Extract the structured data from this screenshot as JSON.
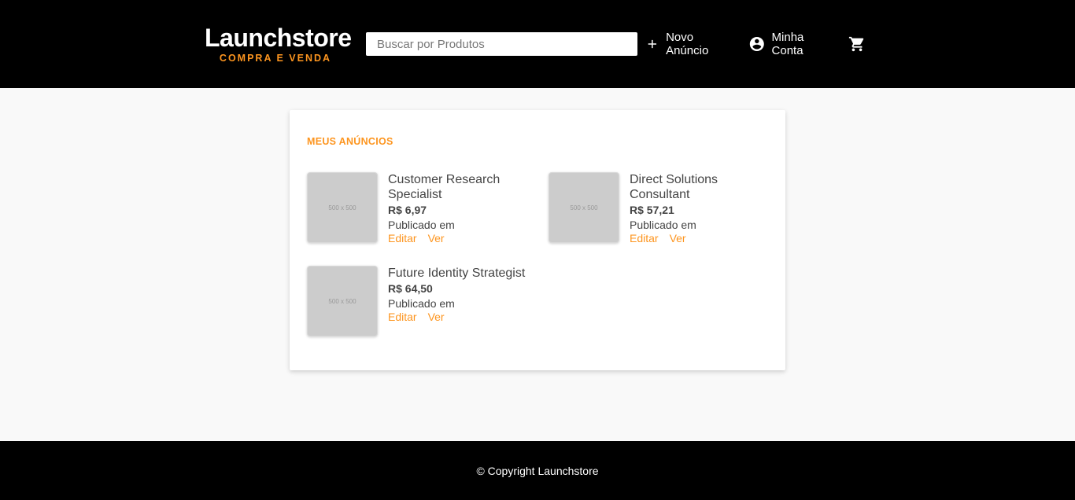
{
  "header": {
    "logo_title": "Launchstore",
    "logo_subtitle": "COMPRA E VENDA",
    "search_placeholder": "Buscar por Produtos",
    "new_ad_label": "Novo Anúncio",
    "account_label": "Minha Conta"
  },
  "main": {
    "section_title": "MEUS ANÚNCIOS",
    "products": [
      {
        "name": "Customer Research Specialist",
        "price": "R$ 6,97",
        "published": "Publicado em",
        "edit_label": "Editar",
        "view_label": "Ver",
        "thumb_label": "500 x 500"
      },
      {
        "name": "Direct Solutions Consultant",
        "price": "R$ 57,21",
        "published": "Publicado em",
        "edit_label": "Editar",
        "view_label": "Ver",
        "thumb_label": "500 x 500"
      },
      {
        "name": "Future Identity Strategist",
        "price": "R$ 64,50",
        "published": "Publicado em",
        "edit_label": "Editar",
        "view_label": "Ver",
        "thumb_label": "500 x 500"
      }
    ]
  },
  "footer": {
    "copyright": "© Copyright Launchstore"
  },
  "colors": {
    "accent": "#fd951f",
    "header_bg": "#000000",
    "page_bg": "#f9f9f9"
  },
  "icons": {
    "new_ad": "plus-icon",
    "account": "account-circle-icon",
    "cart": "shopping-cart-icon"
  }
}
